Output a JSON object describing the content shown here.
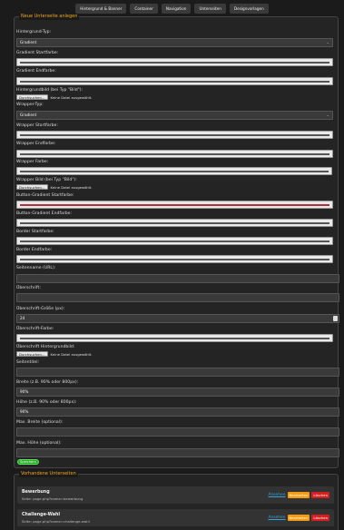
{
  "tabs": [
    "Hintergrund & Banner",
    "Container",
    "Navigation",
    "Unterseiten",
    "Designvorlagen"
  ],
  "form": {
    "legend": "Neue Unterseite anlegen",
    "bg_type_label": "Hintergrund-Typ:",
    "bg_type_value": "Gradient",
    "grad_start_label": "Gradient Startfarbe:",
    "grad_end_label": "Gradient Endfarbe:",
    "bg_image_label": "Hintergrundbild (bei Typ \"Bild\"):",
    "file_button": "Durchsuchen...",
    "no_file": "Keine Datei ausgewählt.",
    "wrapper_type_label": "Wrapper-Typ:",
    "wrapper_type_value": "Gradient",
    "wrapper_start_label": "Wrapper Startfarbe:",
    "wrapper_end_label": "Wrapper Endfarbe:",
    "wrapper_color_label": "Wrapper Farbe:",
    "wrapper_image_label": "Wrapper Bild (bei Typ \"Bild\"):",
    "btn_grad_start_label": "Button-Gradient Startfarbe:",
    "btn_grad_end_label": "Button-Gradient Endfarbe:",
    "border_start_label": "Border Startfarbe:",
    "border_end_label": "Border Endfarbe:",
    "page_name_label": "Seitenname (URL):",
    "heading_label": "Überschrift:",
    "heading_size_label": "Überschrift-Größe (px):",
    "heading_size_value": "24",
    "heading_color_label": "Überschrift-Farbe:",
    "heading_bg_label": "Überschrift Hintergrundbild:",
    "page_title_label": "Seitentitel:",
    "width_label": "Breite (z.B. 90% oder 800px):",
    "width_value": "90%",
    "height_label": "Höhe (z.B. 90% oder 800px):",
    "height_value": "90%",
    "max_width_label": "Max. Breite (optional):",
    "max_height_label": "Max. Höhe (optional):",
    "save_button": "Speichern"
  },
  "existing": {
    "legend": "Vorhandene Unterseiten",
    "view_label": "Ansehen",
    "edit_label": "Bearbeiten",
    "delete_label": "Löschen",
    "items": [
      {
        "title": "Bewerbung",
        "url": "Seite: page.php?name=bewerbung"
      },
      {
        "title": "Challenge-Wahl",
        "url": "Seite: page.php?name=challenge-wahl"
      }
    ]
  },
  "colors": {
    "accent": "#f5a623",
    "save": "#2aaa2a",
    "edit": "#f39c12",
    "delete": "#d51f1f",
    "link": "#36a3d9"
  }
}
